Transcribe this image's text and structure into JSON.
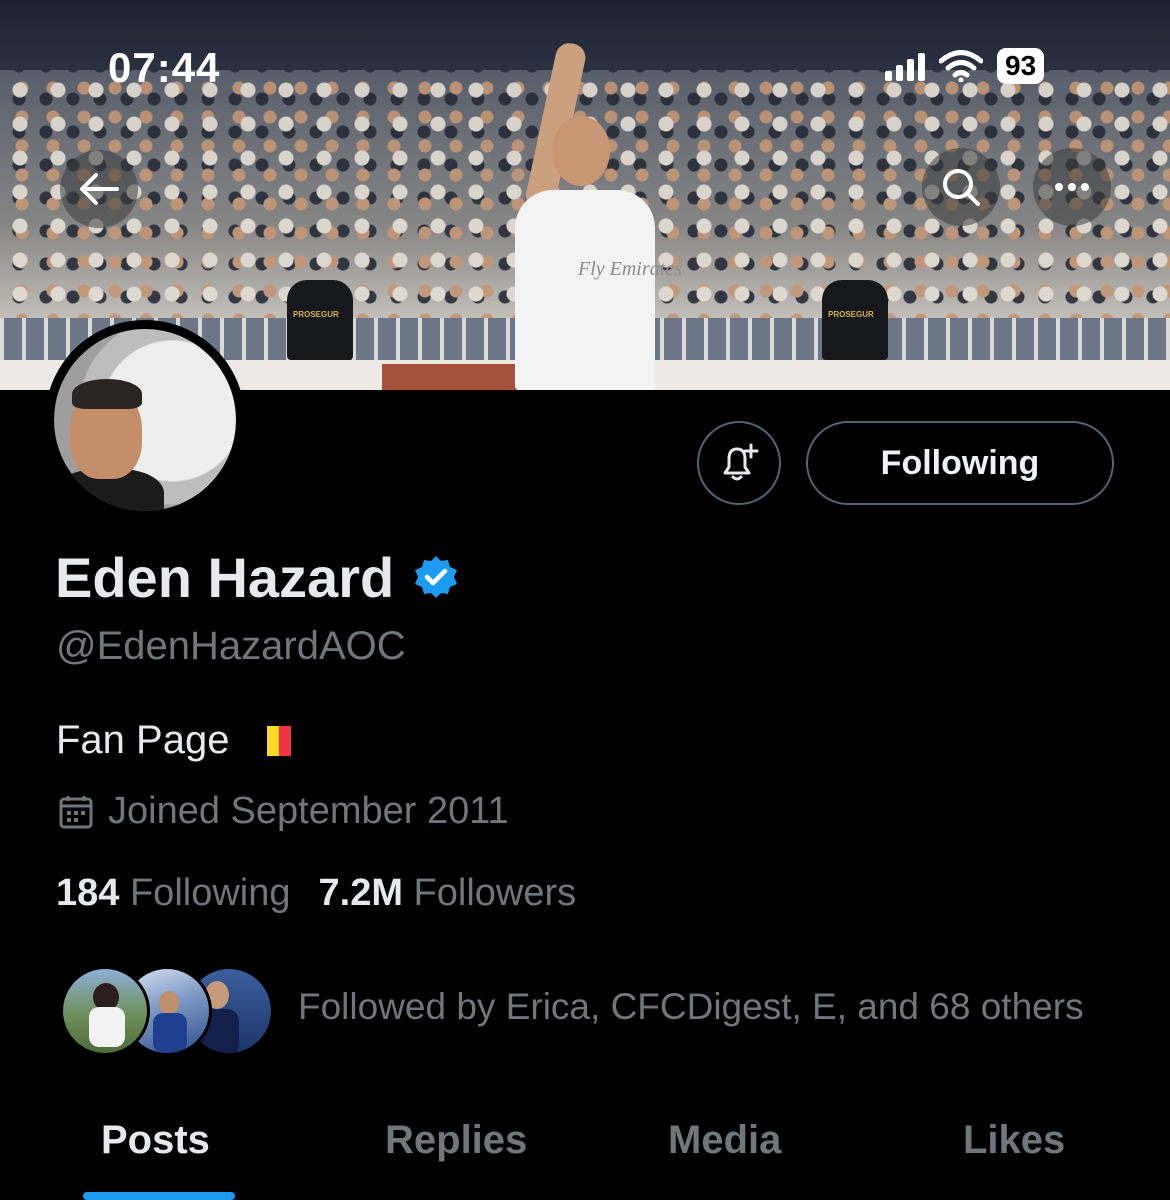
{
  "status_bar": {
    "time": "07:44",
    "battery": "93"
  },
  "header": {
    "back_icon": "arrow-left-icon",
    "search_icon": "search-icon",
    "more_icon": "more-horizontal-icon",
    "banner_sponsor_text": "Fly Emirates",
    "guard_label": "PROSEGUR"
  },
  "actions": {
    "notify_icon": "bell-plus-icon",
    "follow_label": "Following"
  },
  "profile": {
    "name": "Eden Hazard",
    "verified": true,
    "handle": "@EdenHazardAOC",
    "bio": "Fan Page",
    "bio_flag_colors": [
      "#000000",
      "#FDDA24",
      "#EF3340"
    ],
    "joined": "Joined September 2011",
    "following_count": "184",
    "following_label": "Following",
    "followers_count": "7.2M",
    "followers_label": "Followers",
    "followed_by": "Followed by Erica, CFCDigest, E, and 68 others"
  },
  "tabs": [
    {
      "label": "Posts",
      "active": true
    },
    {
      "label": "Replies",
      "active": false
    },
    {
      "label": "Media",
      "active": false
    },
    {
      "label": "Likes",
      "active": false
    }
  ],
  "colors": {
    "accent": "#1d9bf0",
    "background": "#000000",
    "secondary_text": "#71767b"
  }
}
